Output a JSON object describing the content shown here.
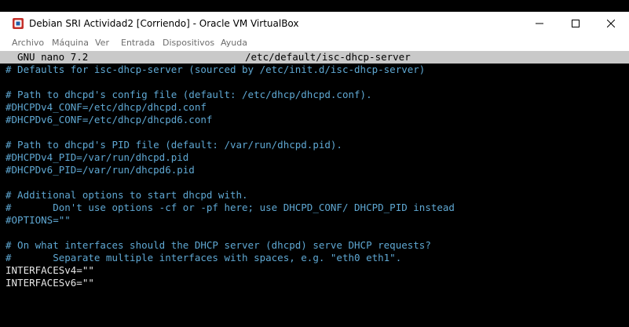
{
  "window": {
    "title": "Debian SRI Actividad2 [Corriendo] - Oracle VM VirtualBox",
    "icon": "virtualbox-icon"
  },
  "menu": [
    "Archivo",
    "Máquina",
    "Ver",
    "Entrada",
    "Dispositivos",
    "Ayuda"
  ],
  "editor": {
    "name": "GNU nano 7.2",
    "file": "/etc/default/isc-dhcp-server"
  },
  "lines": [
    {
      "text": "# Defaults for isc-dhcp-server (sourced by /etc/init.d/isc-dhcp-server)",
      "kind": "comment"
    },
    {
      "text": "",
      "kind": "blank"
    },
    {
      "text": "# Path to dhcpd's config file (default: /etc/dhcp/dhcpd.conf).",
      "kind": "comment"
    },
    {
      "text": "#DHCPDv4_CONF=/etc/dhcp/dhcpd.conf",
      "kind": "comment"
    },
    {
      "text": "#DHCPDv6_CONF=/etc/dhcp/dhcpd6.conf",
      "kind": "comment"
    },
    {
      "text": "",
      "kind": "blank"
    },
    {
      "text": "# Path to dhcpd's PID file (default: /var/run/dhcpd.pid).",
      "kind": "comment"
    },
    {
      "text": "#DHCPDv4_PID=/var/run/dhcpd.pid",
      "kind": "comment"
    },
    {
      "text": "#DHCPDv6_PID=/var/run/dhcpd6.pid",
      "kind": "comment"
    },
    {
      "text": "",
      "kind": "blank"
    },
    {
      "text": "# Additional options to start dhcpd with.",
      "kind": "comment"
    },
    {
      "text": "#       Don't use options -cf or -pf here; use DHCPD_CONF/ DHCPD_PID instead",
      "kind": "comment"
    },
    {
      "text": "#OPTIONS=\"\"",
      "kind": "comment"
    },
    {
      "text": "",
      "kind": "blank"
    },
    {
      "text": "# On what interfaces should the DHCP server (dhcpd) serve DHCP requests?",
      "kind": "comment"
    },
    {
      "text": "#       Separate multiple interfaces with spaces, e.g. \"eth0 eth1\".",
      "kind": "comment"
    },
    {
      "text": "INTERFACESv4=\"\"",
      "kind": "plain"
    },
    {
      "text": "INTERFACESv6=\"\"",
      "kind": "plain"
    }
  ],
  "colors": {
    "comment": "#5fa8d3",
    "plain": "#e6e6e6",
    "status_bar": "#c9c9c9"
  }
}
